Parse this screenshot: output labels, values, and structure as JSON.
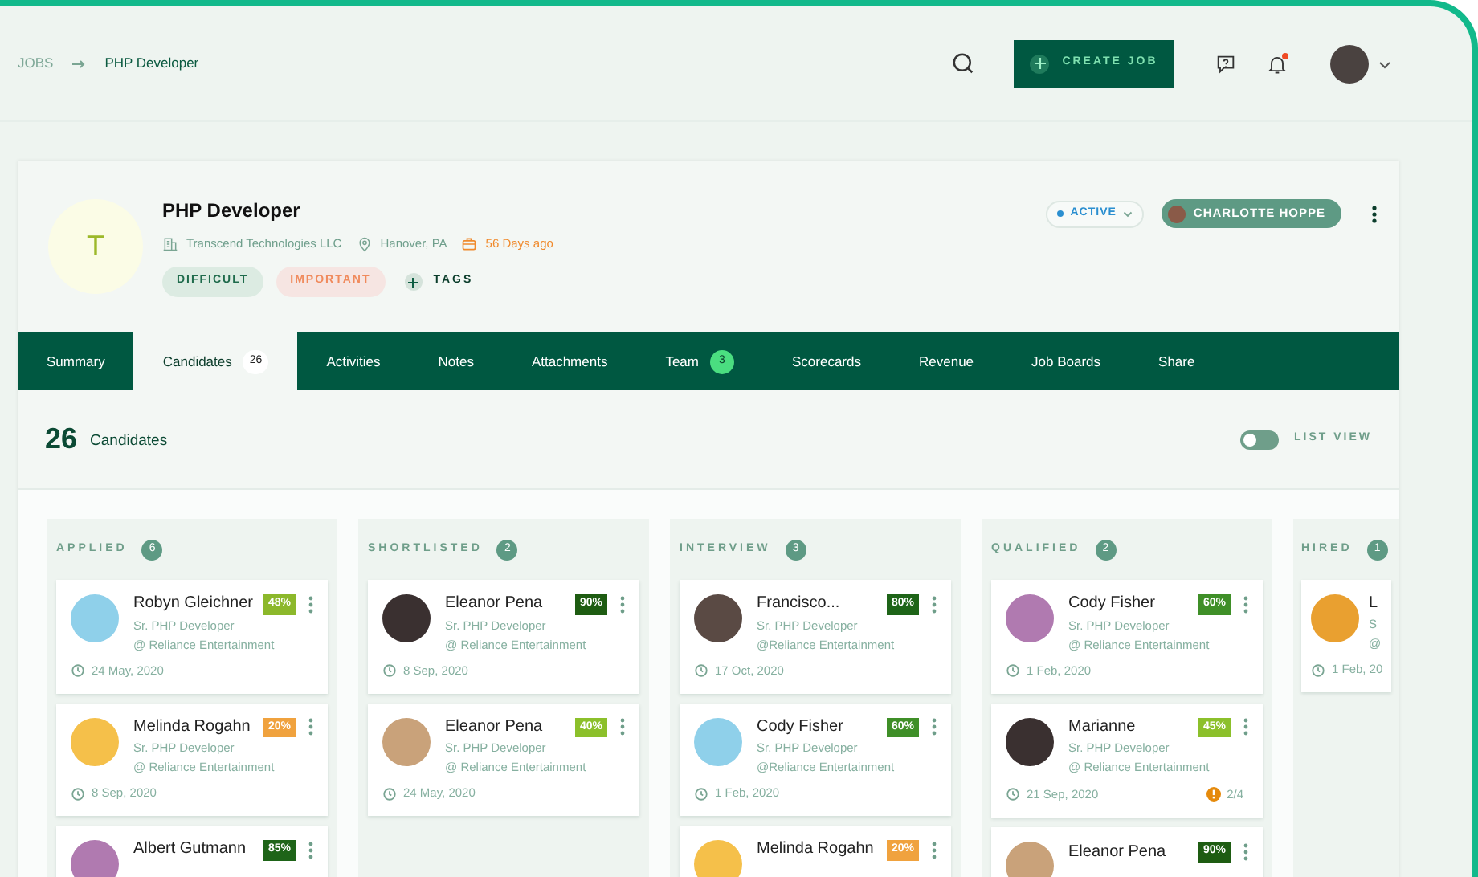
{
  "breadcrumb": [
    {
      "label": "JOBS",
      "selected": false
    },
    {
      "label": "PHP Developer",
      "selected": true
    }
  ],
  "topbar": {
    "create_button": "CREATE JOB",
    "notification_unread": true
  },
  "job": {
    "avatar_letter": "T",
    "title": "PHP Developer",
    "company": "Transcend Technologies LLC",
    "location": "Hanover, PA",
    "age": "56 Days ago",
    "tags": [
      {
        "label": "DIFFICULT",
        "kind": "difficult"
      },
      {
        "label": "IMPORTANT",
        "kind": "important"
      }
    ],
    "add_tags": "TAGS",
    "status": "ACTIVE",
    "owner": "CHARLOTTE HOPPE"
  },
  "tabs": [
    {
      "label": "Summary",
      "selected": false
    },
    {
      "label": "Candidates",
      "count": "26",
      "selected": true
    },
    {
      "label": "Activities",
      "selected": false
    },
    {
      "label": "Notes",
      "selected": false
    },
    {
      "label": "Attachments",
      "selected": false
    },
    {
      "label": "Team",
      "count": "3",
      "selected": false
    },
    {
      "label": "Scorecards",
      "selected": false
    },
    {
      "label": "Revenue",
      "selected": false
    },
    {
      "label": "Job Boards",
      "selected": false
    },
    {
      "label": "Share",
      "selected": false
    }
  ],
  "summary": {
    "count": "26",
    "label": "Candidates",
    "list_view": {
      "label": "LIST VIEW",
      "on": false
    }
  },
  "columns": [
    {
      "title": "APPLIED",
      "count": "6",
      "cards": [
        {
          "name": "Robyn Gleichner",
          "role": "Sr. PHP Developer",
          "company": "@ Reliance Entertainment",
          "date": "24 May, 2020",
          "score": "48%",
          "color": "#8cb82b"
        },
        {
          "name": "Melinda Rogahn",
          "role": "Sr. PHP Developer",
          "company": "@ Reliance Entertainment",
          "date": "8 Sep, 2020",
          "score": "20%",
          "color": "#f0a23e"
        },
        {
          "name": "Albert Gutmann",
          "score": "85%",
          "color": "#1e6418"
        }
      ]
    },
    {
      "title": "SHORTLISTED",
      "count": "2",
      "cards": [
        {
          "name": "Eleanor Pena",
          "role": "Sr. PHP Developer",
          "company": "@ Reliance Entertainment",
          "date": "8 Sep, 2020",
          "score": "90%",
          "color": "#1e5c12"
        },
        {
          "name": "Eleanor Pena",
          "role": "Sr. PHP Developer",
          "company": "@ Reliance Entertainment",
          "date": "24 May, 2020",
          "score": "40%",
          "color": "#8cc02b"
        }
      ]
    },
    {
      "title": "INTERVIEW",
      "count": "3",
      "cards": [
        {
          "name": "Francisco...",
          "role": "Sr. PHP Developer",
          "company": "@Reliance Entertainment",
          "date": "17 Oct, 2020",
          "score": "80%",
          "color": "#1e6418"
        },
        {
          "name": "Cody Fisher",
          "role": "Sr. PHP Developer",
          "company": "@Reliance Entertainment",
          "date": "1 Feb, 2020",
          "score": "60%",
          "color": "#3f8f28"
        },
        {
          "name": "Melinda Rogahn",
          "score": "20%",
          "color": "#f0a23e"
        }
      ]
    },
    {
      "title": "QUALIFIED",
      "count": "2",
      "cards": [
        {
          "name": "Cody Fisher",
          "role": "Sr. PHP Developer",
          "company": "@ Reliance Entertainment",
          "date": "1 Feb, 2020",
          "score": "60%",
          "color": "#3f8f28"
        },
        {
          "name": "Marianne",
          "role": "Sr. PHP Developer",
          "company": "@ Reliance Entertainment",
          "date": "21 Sep, 2020",
          "score": "45%",
          "color": "#8cc02b",
          "alert": "2/4"
        },
        {
          "name": "Eleanor Pena",
          "score": "90%",
          "color": "#1e5c12"
        }
      ]
    },
    {
      "title": "HIRED",
      "count": "1",
      "cards": [
        {
          "name": "L",
          "role": "S",
          "company": "@",
          "date": "1 Feb, 20"
        }
      ]
    }
  ]
}
